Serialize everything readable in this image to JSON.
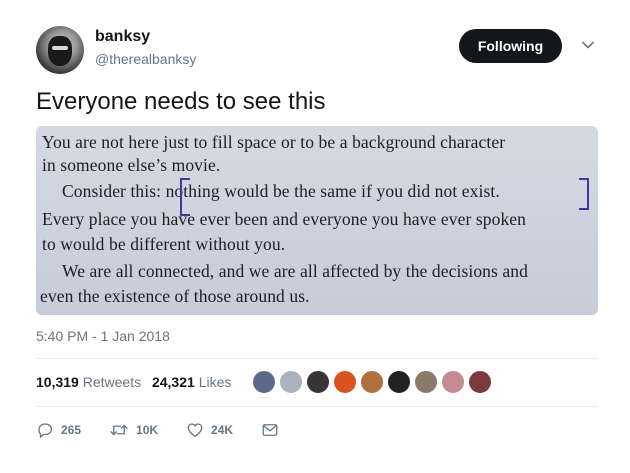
{
  "user": {
    "display_name": "banksy",
    "handle": "@therealbanksy",
    "follow_label": "Following"
  },
  "tweet": {
    "text": "Everyone needs to see this",
    "timestamp": "5:40 PM - 1 Jan 2018"
  },
  "photo": {
    "lines": [
      "You are not here just to fill space or to be a background character",
      "in someone else’s movie.",
      "Consider this: nothing would be the same if you did not exist.",
      "Every place you have ever been and everyone you have ever spoken",
      "to would be different without you.",
      "We are all connected, and we are all affected by the decisions and",
      "even the existence of those around us."
    ]
  },
  "stats": {
    "retweets_count": "10,319",
    "retweets_label": "Retweets",
    "likes_count": "24,321",
    "likes_label": "Likes"
  },
  "likers": [
    {
      "name": "liker-avatar-1",
      "color": "#5a6b8c"
    },
    {
      "name": "liker-avatar-2",
      "color": "#aab3bd"
    },
    {
      "name": "liker-avatar-3",
      "color": "#3a3434"
    },
    {
      "name": "liker-avatar-4",
      "color": "#d9531e"
    },
    {
      "name": "liker-avatar-5",
      "color": "#b07040"
    },
    {
      "name": "liker-avatar-6",
      "color": "#222222"
    },
    {
      "name": "liker-avatar-7",
      "color": "#8a7a68"
    },
    {
      "name": "liker-avatar-8",
      "color": "#c58b90"
    },
    {
      "name": "liker-avatar-9",
      "color": "#7c3a3a"
    }
  ],
  "actions": {
    "reply_count": "265",
    "retweet_count": "10K",
    "like_count": "24K"
  },
  "colors": {
    "text": "#14171a",
    "secondary": "#657786",
    "divider": "#e6ecf0",
    "bracket": "#3f3a9a"
  },
  "icons": [
    "caret-down-icon",
    "reply-icon",
    "retweet-icon",
    "like-icon",
    "direct-message-icon"
  ]
}
